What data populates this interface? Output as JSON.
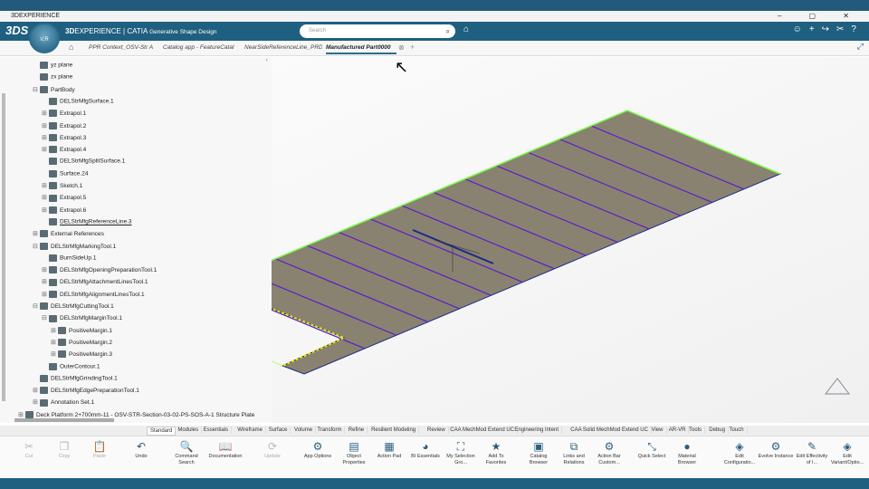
{
  "window": {
    "title": "3DEXPERIENCE",
    "controls": "– ▢ ✕"
  },
  "app": {
    "brand": "3D",
    "brand_rest": "EXPERIENCE | CATIA",
    "app_name": "Generative Shape Design",
    "compass_label": "V,R",
    "search_placeholder": "Search"
  },
  "tabs": [
    "PPR Context_OSV-Str A",
    "Catalog app - FeatureCatal",
    "NearSideReferenceLine_PRD",
    "Manufactured Part0000"
  ],
  "active_tab": 3,
  "tree": [
    {
      "label": "yz plane",
      "level": 1,
      "pm": ""
    },
    {
      "label": "zx plane",
      "level": 1,
      "pm": ""
    },
    {
      "label": "PartBody",
      "level": 1,
      "pm": "⊟"
    },
    {
      "label": "DELStrMfgSurface.1",
      "level": 2,
      "pm": ""
    },
    {
      "label": "Extrapol.1",
      "level": 2,
      "pm": "⊞"
    },
    {
      "label": "Extrapol.2",
      "level": 2,
      "pm": "⊞"
    },
    {
      "label": "Extrapol.3",
      "level": 2,
      "pm": "⊞"
    },
    {
      "label": "Extrapol.4",
      "level": 2,
      "pm": "⊞"
    },
    {
      "label": "DELStrMfgSplitSurface.1",
      "level": 2,
      "pm": ""
    },
    {
      "label": "Surface.24",
      "level": 2,
      "pm": ""
    },
    {
      "label": "Sketch.1",
      "level": 2,
      "pm": "⊞"
    },
    {
      "label": "Extrapol.5",
      "level": 2,
      "pm": "⊞"
    },
    {
      "label": "Extrapol.6",
      "level": 2,
      "pm": "⊞"
    },
    {
      "label": "DELStrMfgReferenceLine.3",
      "level": 2,
      "pm": ""
    },
    {
      "label": "External References",
      "level": 1,
      "pm": "⊞"
    },
    {
      "label": "DELStrMfgMarkingTool.1",
      "level": 1,
      "pm": "⊟"
    },
    {
      "label": "BurnSideUp.1",
      "level": 2,
      "pm": ""
    },
    {
      "label": "DELStrMfgOpeningPreparationTool.1",
      "level": 2,
      "pm": "⊞"
    },
    {
      "label": "DELStrMfgAttachmentLinesTool.1",
      "level": 2,
      "pm": "⊞"
    },
    {
      "label": "DELStrMfgAlignmentLinesTool.1",
      "level": 2,
      "pm": "⊞"
    },
    {
      "label": "DELStrMfgCuttingTool.1",
      "level": 1,
      "pm": "⊟"
    },
    {
      "label": "DELStrMfgMarginTool.1",
      "level": 2,
      "pm": "⊟"
    },
    {
      "label": "PositiveMargin.1",
      "level": 3,
      "pm": "⊞"
    },
    {
      "label": "PositiveMargin.2",
      "level": 3,
      "pm": "⊞"
    },
    {
      "label": "PositiveMargin.3",
      "level": 3,
      "pm": "⊞"
    },
    {
      "label": "OuterContour.1",
      "level": 2,
      "pm": ""
    },
    {
      "label": "DELStrMfgGrindingTool.1",
      "level": 1,
      "pm": ""
    },
    {
      "label": "DELStrMfgEdgePreparationTool.1",
      "level": 1,
      "pm": "⊞"
    },
    {
      "label": "Annotation Set.1",
      "level": 1,
      "pm": "⊞"
    },
    {
      "label": "Deck Platform 2+700mm-11 - OSV-STR-Section-03-02-PS-SOS-A-1 Structure Plate",
      "level": 0,
      "pm": "⊞"
    }
  ],
  "toolbar_tabs": [
    "Standard",
    "Modules",
    "Essentials",
    "Wireframe",
    "Surface",
    "Volume",
    "Transform",
    "Refine",
    "Resilient Modeling",
    "Review",
    "CAA MechMod Extend UC",
    "Engineering Intent",
    "CAA Solid MechMod Extend UC",
    "View",
    "AR-VR",
    "Tools",
    "Debug",
    "Touch"
  ],
  "active_toolbar_tab": 0,
  "tools": [
    {
      "label": "Cut",
      "icon": "✂",
      "disabled": true
    },
    {
      "label": "Copy",
      "icon": "❐",
      "disabled": true
    },
    {
      "label": "Paste",
      "icon": "📋",
      "disabled": true
    },
    {
      "label": "Undo",
      "icon": "↶",
      "disabled": false
    },
    {
      "label": "Command Search",
      "icon": "🔍",
      "disabled": false
    },
    {
      "label": "Documentation",
      "icon": "📖",
      "disabled": false
    },
    {
      "label": "Update",
      "icon": "⟳",
      "disabled": true
    },
    {
      "label": "App Options",
      "icon": "⚙",
      "disabled": false
    },
    {
      "label": "Object Properties",
      "icon": "▤",
      "disabled": false
    },
    {
      "label": "Action Pad",
      "icon": "▦",
      "disabled": false
    },
    {
      "label": "BI Essentials",
      "icon": "◕",
      "disabled": false
    },
    {
      "label": "My Selection Gro...",
      "icon": "⛶",
      "disabled": false
    },
    {
      "label": "Add To Favorites",
      "icon": "★",
      "disabled": false
    },
    {
      "label": "Catalog Browser",
      "icon": "▣",
      "disabled": false
    },
    {
      "label": "Links and Relations",
      "icon": "⧉",
      "disabled": false
    },
    {
      "label": "Action Bar Custom...",
      "icon": "⚙",
      "disabled": false
    },
    {
      "label": "Quick Select",
      "icon": "⤡",
      "disabled": false
    },
    {
      "label": "Material Browser",
      "icon": "●",
      "disabled": false
    },
    {
      "label": "Edit Configuratio...",
      "icon": "◈",
      "disabled": false
    },
    {
      "label": "Evolve Instance",
      "icon": "⚙",
      "disabled": false
    },
    {
      "label": "Edit Effectivity of I...",
      "icon": "✎",
      "disabled": false
    },
    {
      "label": "Edit Variant/Optio...",
      "icon": "◈",
      "disabled": false
    }
  ],
  "colors": {
    "appbar": "#1f5f80",
    "plate": "#8a8270",
    "marking_lines": "#5a1fc8",
    "edge": "#7cff4a",
    "margin": "#f0f000"
  }
}
